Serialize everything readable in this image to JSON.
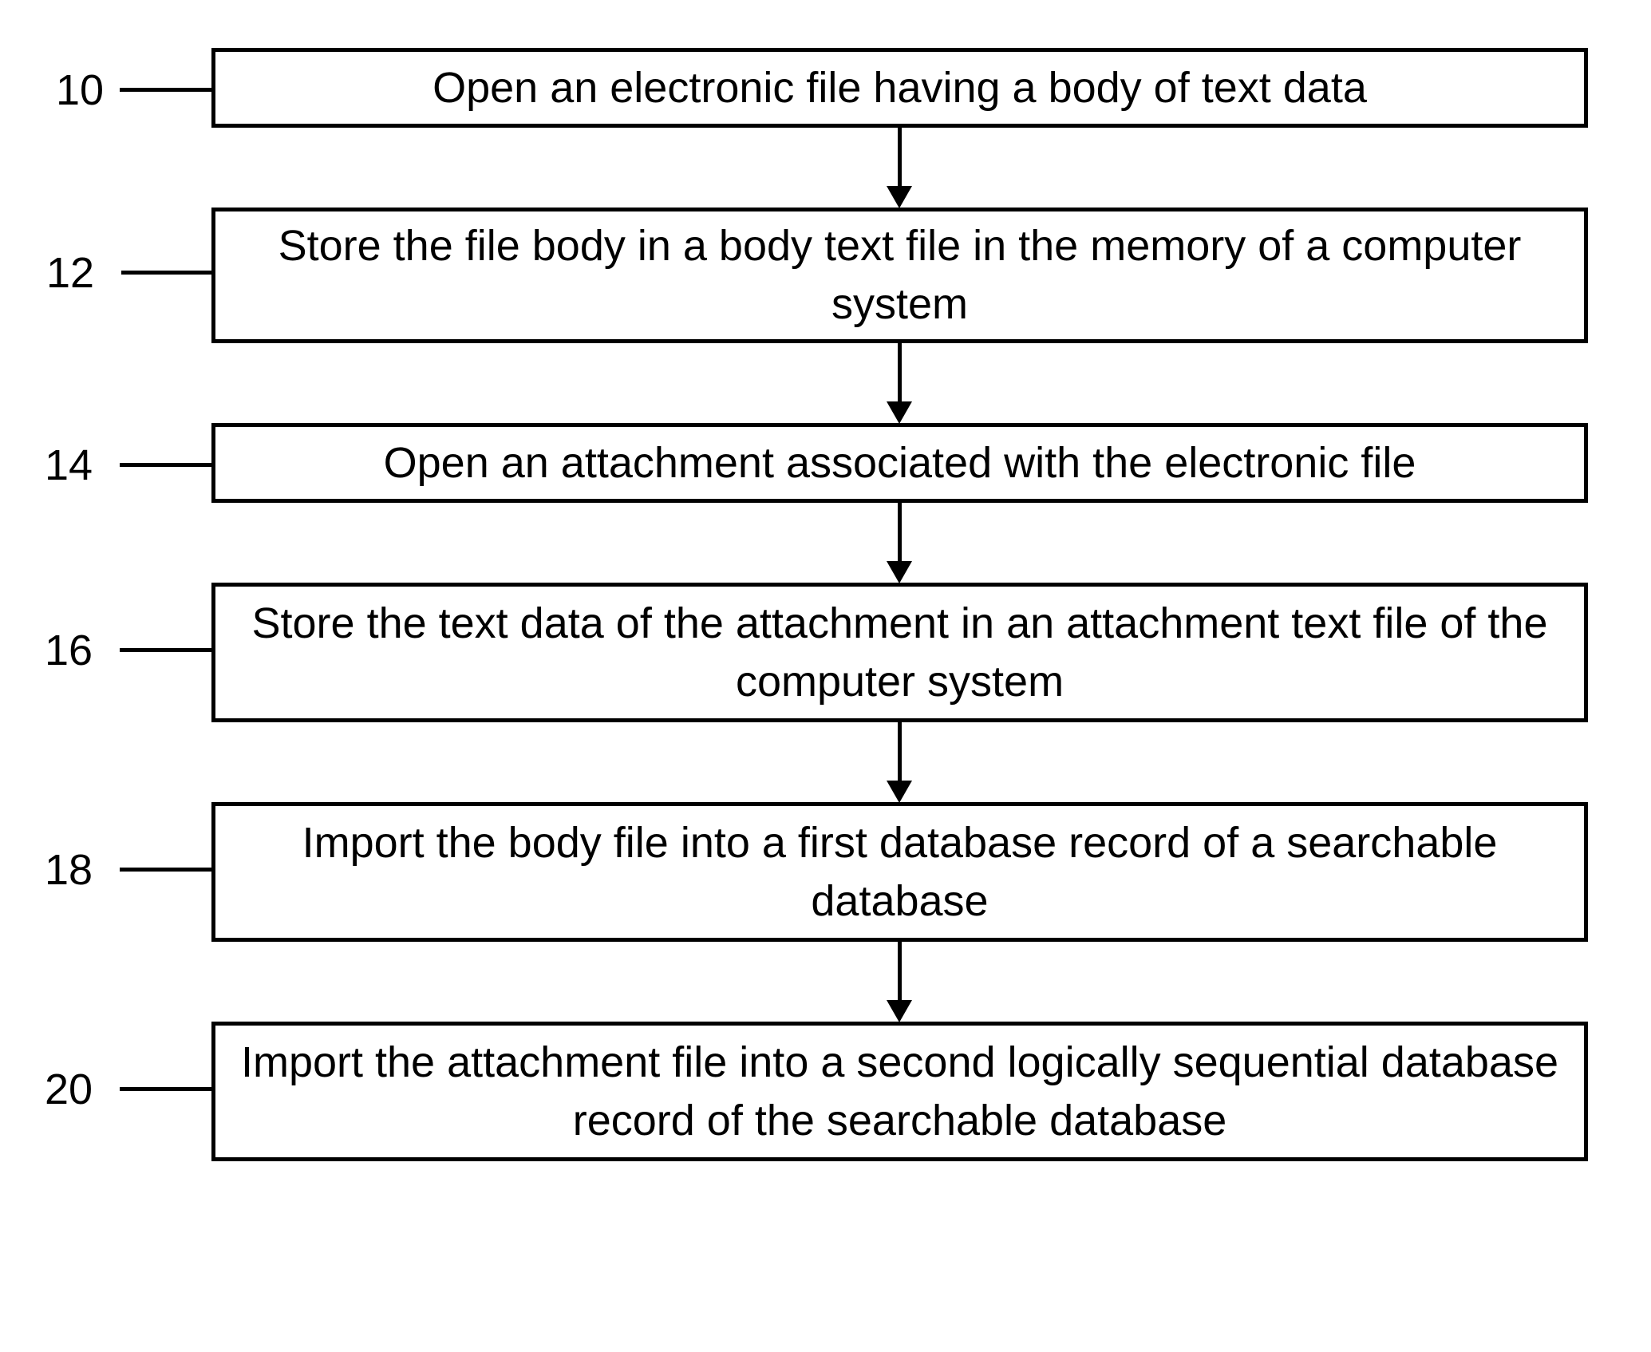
{
  "chart_data": {
    "type": "flowchart",
    "direction": "top-down",
    "steps": [
      {
        "id": "10",
        "label": "10",
        "text": "Open an electronic file having a body of text data"
      },
      {
        "id": "12",
        "label": "12",
        "text": "Store the file body in a body text file in the memory of a computer system"
      },
      {
        "id": "14",
        "label": "14",
        "text": "Open an attachment associated with the electronic file"
      },
      {
        "id": "16",
        "label": "16",
        "text": "Store the text data of the attachment in an attachment text file of the computer system"
      },
      {
        "id": "18",
        "label": "18",
        "text": "Import the body file into a first database record of a searchable database"
      },
      {
        "id": "20",
        "label": "20",
        "text": "Import the attachment file into a second logically sequential database record of the searchable database"
      }
    ],
    "edges": [
      [
        "10",
        "12"
      ],
      [
        "12",
        "14"
      ],
      [
        "14",
        "16"
      ],
      [
        "16",
        "18"
      ],
      [
        "18",
        "20"
      ]
    ]
  }
}
